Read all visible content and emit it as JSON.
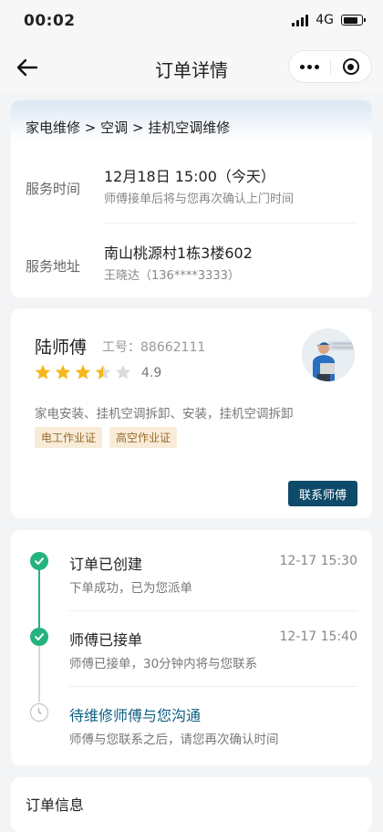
{
  "status_bar": {
    "time": "00:02",
    "network": "4G"
  },
  "nav": {
    "title": "订单详情"
  },
  "service": {
    "breadcrumb": "家电维修 > 空调 > 挂机空调维修",
    "time_label": "服务时间",
    "time_value": "12月18日  15:00（今天）",
    "time_note": "师傅接单后将与您再次确认上门时间",
    "address_label": "服务地址",
    "address_value": "南山桃源村1栋3楼602",
    "contact": "王晓达（136****3333）"
  },
  "master": {
    "name": "陆师傅",
    "work_no": "工号：88662111",
    "rating": "4.9",
    "stars": 3.5,
    "star_color": "#f5b719",
    "skills": "家电安装、挂机空调拆卸、安装，挂机空调拆卸",
    "certificates": [
      "电工作业证",
      "高空作业证"
    ],
    "contact_button": "联系师傅"
  },
  "timeline": [
    {
      "title": "订单已创建",
      "time": "12-17 15:30",
      "desc": "下单成功，已为您派单",
      "state": "done"
    },
    {
      "title": "师傅已接单",
      "time": "12-17 15:40",
      "desc": "师傅已接单，30分钟内将与您联系",
      "state": "done"
    },
    {
      "title": "待维修师傅与您沟通",
      "time": "",
      "desc": "师傅与您联系之后，请您再次确认时间",
      "state": "pending"
    }
  ],
  "order_info": {
    "title": "订单信息"
  },
  "colors": {
    "accent": "#0e4a6a",
    "success": "#25b27f",
    "tag_bg": "#f8ecd9",
    "tag_text": "#9a6b2c"
  }
}
